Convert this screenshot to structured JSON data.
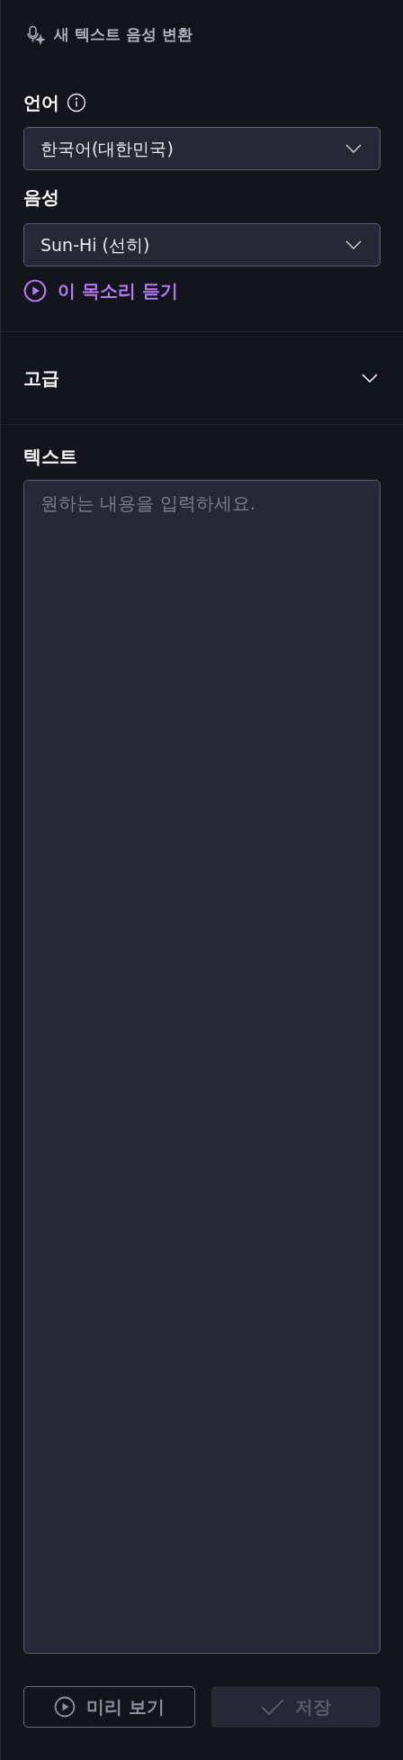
{
  "header": {
    "title": "새 텍스트 음성 변환"
  },
  "language": {
    "label": "언어",
    "value": "한국어(대한민국)"
  },
  "voice": {
    "label": "음성",
    "value": "Sun-Hi (선히)",
    "listen": "이 목소리 듣기"
  },
  "advanced": {
    "label": "고급",
    "expanded": false
  },
  "text": {
    "label": "텍스트",
    "placeholder": "원하는 내용을 입력하세요."
  },
  "buttons": [
    {
      "kind": "preview",
      "label": "미리 보기",
      "disabled": false
    },
    {
      "kind": "save",
      "label": "저장",
      "disabled": true
    }
  ]
}
